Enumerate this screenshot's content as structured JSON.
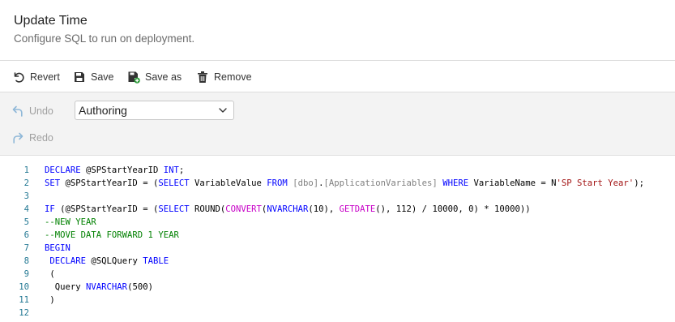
{
  "header": {
    "title": "Update Time",
    "subtitle": "Configure SQL to run on deployment."
  },
  "toolbar": {
    "revert_label": "Revert",
    "save_label": "Save",
    "save_as_label": "Save as",
    "remove_label": "Remove"
  },
  "editor_toolbar": {
    "undo_label": "Undo",
    "redo_label": "Redo",
    "mode_select_value": "Authoring"
  },
  "code": {
    "line_numbers": [
      "1",
      "2",
      "3",
      "4",
      "5",
      "6",
      "7",
      "8",
      "9",
      "10",
      "11",
      "12"
    ],
    "lines": [
      [
        [
          "kw",
          "DECLARE"
        ],
        [
          "p",
          " @SPStartYearID "
        ],
        [
          "kw",
          "INT"
        ],
        [
          "p",
          ";"
        ]
      ],
      [
        [
          "kw",
          "SET"
        ],
        [
          "p",
          " @SPStartYearID = ("
        ],
        [
          "kw",
          "SELECT"
        ],
        [
          "p",
          " VariableValue "
        ],
        [
          "kw",
          "FROM"
        ],
        [
          "p",
          " "
        ],
        [
          "obj",
          "[dbo]"
        ],
        [
          "p",
          "."
        ],
        [
          "obj",
          "[ApplicationVariables]"
        ],
        [
          "p",
          " "
        ],
        [
          "kw",
          "WHERE"
        ],
        [
          "p",
          " VariableName = N"
        ],
        [
          "str",
          "'SP Start Year'"
        ],
        [
          "p",
          ");"
        ]
      ],
      [],
      [
        [
          "kw",
          "IF"
        ],
        [
          "p",
          " (@SPStartYearID = ("
        ],
        [
          "kw",
          "SELECT"
        ],
        [
          "p",
          " ROUND("
        ],
        [
          "fn",
          "CONVERT"
        ],
        [
          "p",
          "("
        ],
        [
          "kw",
          "NVARCHAR"
        ],
        [
          "p",
          "(10), "
        ],
        [
          "fn",
          "GETDATE"
        ],
        [
          "p",
          "(), 112) / 10000, 0) * 10000))"
        ]
      ],
      [
        [
          "cmt",
          "--NEW YEAR"
        ]
      ],
      [
        [
          "cmt",
          "--MOVE DATA FORWARD 1 YEAR"
        ]
      ],
      [
        [
          "kw",
          "BEGIN"
        ]
      ],
      [
        [
          "p",
          " "
        ],
        [
          "kw",
          "DECLARE"
        ],
        [
          "p",
          " @SQLQuery "
        ],
        [
          "kw",
          "TABLE"
        ]
      ],
      [
        [
          "p",
          " ("
        ]
      ],
      [
        [
          "p",
          "  Query "
        ],
        [
          "kw",
          "NVARCHAR"
        ],
        [
          "p",
          "(500)"
        ]
      ],
      [
        [
          "p",
          " )"
        ]
      ],
      []
    ]
  }
}
